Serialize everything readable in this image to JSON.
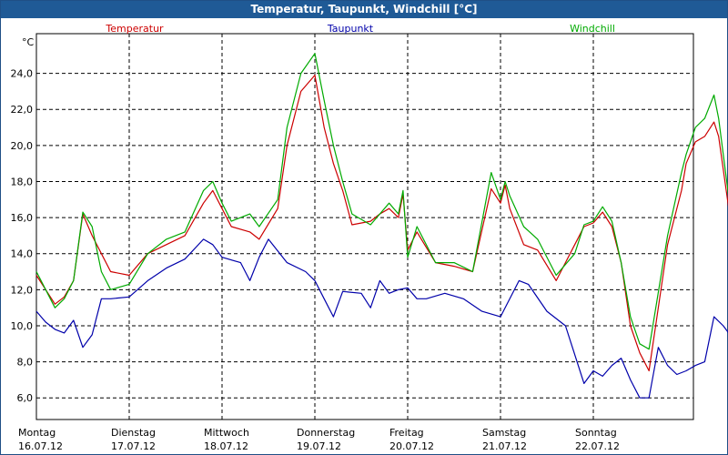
{
  "header": {
    "title": "Temperatur, Taupunkt, Windchill [°C]"
  },
  "chart_data": {
    "type": "line",
    "title": "Temperatur, Taupunkt, Windchill [°C]",
    "ylabel": "°C",
    "ylim": [
      4.8,
      26.2
    ],
    "xlim": [
      0,
      7
    ],
    "grid": true,
    "legend_position": "top",
    "yticks": [
      "6,0",
      "8,0",
      "10,0",
      "12,0",
      "14,0",
      "16,0",
      "18,0",
      "20,0",
      "22,0",
      "24,0"
    ],
    "ytick_values": [
      6,
      8,
      10,
      12,
      14,
      16,
      18,
      20,
      22,
      24
    ],
    "xticks": [
      {
        "day": "Montag",
        "date": "16.07.12"
      },
      {
        "day": "Dienstag",
        "date": "17.07.12"
      },
      {
        "day": "Mittwoch",
        "date": "18.07.12"
      },
      {
        "day": "Donnerstag",
        "date": "19.07.12"
      },
      {
        "day": "Freitag",
        "date": "20.07.12"
      },
      {
        "day": "Samstag",
        "date": "21.07.12"
      },
      {
        "day": "Sonntag",
        "date": "22.07.12"
      }
    ],
    "series": [
      {
        "name": "Temperatur",
        "color": "#cc0000",
        "points": [
          [
            0,
            12.8
          ],
          [
            0.1,
            12.0
          ],
          [
            0.2,
            11.2
          ],
          [
            0.3,
            11.6
          ],
          [
            0.4,
            12.5
          ],
          [
            0.5,
            16.2
          ],
          [
            0.6,
            15.0
          ],
          [
            0.7,
            14.0
          ],
          [
            0.8,
            13.0
          ],
          [
            1.0,
            12.8
          ],
          [
            1.2,
            14.0
          ],
          [
            1.4,
            14.5
          ],
          [
            1.6,
            15.0
          ],
          [
            1.8,
            16.8
          ],
          [
            1.9,
            17.5
          ],
          [
            2.0,
            16.5
          ],
          [
            2.1,
            15.5
          ],
          [
            2.3,
            15.2
          ],
          [
            2.4,
            14.8
          ],
          [
            2.6,
            16.5
          ],
          [
            2.7,
            20.0
          ],
          [
            2.85,
            23.0
          ],
          [
            3.0,
            23.9
          ],
          [
            3.1,
            21.0
          ],
          [
            3.2,
            19.0
          ],
          [
            3.3,
            17.5
          ],
          [
            3.4,
            15.6
          ],
          [
            3.6,
            15.8
          ],
          [
            3.7,
            16.2
          ],
          [
            3.8,
            16.5
          ],
          [
            3.9,
            16.0
          ],
          [
            3.95,
            17.3
          ],
          [
            4.0,
            14.2
          ],
          [
            4.1,
            15.2
          ],
          [
            4.3,
            13.5
          ],
          [
            4.5,
            13.3
          ],
          [
            4.7,
            13.0
          ],
          [
            4.9,
            17.6
          ],
          [
            5.0,
            16.8
          ],
          [
            5.05,
            17.8
          ],
          [
            5.1,
            16.5
          ],
          [
            5.25,
            14.5
          ],
          [
            5.4,
            14.2
          ],
          [
            5.6,
            12.5
          ],
          [
            5.8,
            14.5
          ],
          [
            5.9,
            15.5
          ],
          [
            6.0,
            15.7
          ],
          [
            6.1,
            16.3
          ],
          [
            6.2,
            15.5
          ],
          [
            6.3,
            13.5
          ],
          [
            6.4,
            10.0
          ],
          [
            6.5,
            8.5
          ],
          [
            6.6,
            7.5
          ],
          [
            6.8,
            14.5
          ],
          [
            6.95,
            17.5
          ],
          [
            7.0,
            19.0
          ],
          [
            7.1,
            20.2
          ],
          [
            7.2,
            20.5
          ],
          [
            7.3,
            21.3
          ],
          [
            7.35,
            20.5
          ],
          [
            7.5,
            15.0
          ],
          [
            7.6,
            12.8
          ]
        ]
      },
      {
        "name": "Taupunkt",
        "color": "#0000aa",
        "points": [
          [
            0,
            10.8
          ],
          [
            0.1,
            10.2
          ],
          [
            0.2,
            9.8
          ],
          [
            0.3,
            9.6
          ],
          [
            0.4,
            10.3
          ],
          [
            0.5,
            8.8
          ],
          [
            0.6,
            9.5
          ],
          [
            0.7,
            11.5
          ],
          [
            0.8,
            11.5
          ],
          [
            1.0,
            11.6
          ],
          [
            1.2,
            12.5
          ],
          [
            1.4,
            13.2
          ],
          [
            1.6,
            13.7
          ],
          [
            1.8,
            14.8
          ],
          [
            1.9,
            14.5
          ],
          [
            2.0,
            13.8
          ],
          [
            2.2,
            13.5
          ],
          [
            2.3,
            12.5
          ],
          [
            2.4,
            13.8
          ],
          [
            2.5,
            14.8
          ],
          [
            2.7,
            13.5
          ],
          [
            2.9,
            13.0
          ],
          [
            3.0,
            12.5
          ],
          [
            3.1,
            11.5
          ],
          [
            3.2,
            10.5
          ],
          [
            3.3,
            11.9
          ],
          [
            3.5,
            11.8
          ],
          [
            3.6,
            11.0
          ],
          [
            3.7,
            12.5
          ],
          [
            3.8,
            11.8
          ],
          [
            3.9,
            12.0
          ],
          [
            4.0,
            12.1
          ],
          [
            4.1,
            11.5
          ],
          [
            4.2,
            11.5
          ],
          [
            4.4,
            11.8
          ],
          [
            4.6,
            11.5
          ],
          [
            4.8,
            10.8
          ],
          [
            5.0,
            10.5
          ],
          [
            5.2,
            12.5
          ],
          [
            5.3,
            12.3
          ],
          [
            5.5,
            10.8
          ],
          [
            5.7,
            10.0
          ],
          [
            5.9,
            6.8
          ],
          [
            6.0,
            7.5
          ],
          [
            6.1,
            7.2
          ],
          [
            6.2,
            7.8
          ],
          [
            6.3,
            8.2
          ],
          [
            6.4,
            7.0
          ],
          [
            6.5,
            6.0
          ],
          [
            6.6,
            6.0
          ],
          [
            6.7,
            8.8
          ],
          [
            6.8,
            7.8
          ],
          [
            6.9,
            7.3
          ],
          [
            7.0,
            7.5
          ],
          [
            7.1,
            7.8
          ],
          [
            7.2,
            8.0
          ],
          [
            7.3,
            10.5
          ],
          [
            7.4,
            10.0
          ],
          [
            7.5,
            9.3
          ]
        ]
      },
      {
        "name": "Windchill",
        "color": "#00aa00",
        "points": [
          [
            0,
            13.0
          ],
          [
            0.1,
            12.0
          ],
          [
            0.2,
            11.0
          ],
          [
            0.3,
            11.5
          ],
          [
            0.4,
            12.5
          ],
          [
            0.5,
            16.3
          ],
          [
            0.6,
            15.5
          ],
          [
            0.7,
            13.0
          ],
          [
            0.8,
            12.0
          ],
          [
            1.0,
            12.3
          ],
          [
            1.2,
            14.0
          ],
          [
            1.4,
            14.8
          ],
          [
            1.6,
            15.2
          ],
          [
            1.8,
            17.5
          ],
          [
            1.9,
            18.0
          ],
          [
            2.0,
            16.8
          ],
          [
            2.1,
            15.8
          ],
          [
            2.3,
            16.2
          ],
          [
            2.4,
            15.5
          ],
          [
            2.6,
            17.0
          ],
          [
            2.7,
            21.0
          ],
          [
            2.85,
            24.0
          ],
          [
            3.0,
            25.1
          ],
          [
            3.1,
            22.5
          ],
          [
            3.2,
            20.0
          ],
          [
            3.3,
            18.0
          ],
          [
            3.4,
            16.2
          ],
          [
            3.6,
            15.6
          ],
          [
            3.7,
            16.2
          ],
          [
            3.8,
            16.8
          ],
          [
            3.9,
            16.2
          ],
          [
            3.95,
            17.5
          ],
          [
            4.0,
            13.8
          ],
          [
            4.1,
            15.5
          ],
          [
            4.3,
            13.5
          ],
          [
            4.5,
            13.5
          ],
          [
            4.7,
            13.0
          ],
          [
            4.9,
            18.5
          ],
          [
            5.0,
            17.0
          ],
          [
            5.05,
            18.0
          ],
          [
            5.1,
            17.2
          ],
          [
            5.25,
            15.5
          ],
          [
            5.4,
            14.8
          ],
          [
            5.6,
            12.8
          ],
          [
            5.8,
            14.0
          ],
          [
            5.9,
            15.6
          ],
          [
            6.0,
            15.8
          ],
          [
            6.1,
            16.6
          ],
          [
            6.2,
            15.8
          ],
          [
            6.3,
            13.5
          ],
          [
            6.4,
            10.5
          ],
          [
            6.5,
            9.0
          ],
          [
            6.6,
            8.7
          ],
          [
            6.8,
            15.0
          ],
          [
            6.95,
            18.5
          ],
          [
            7.0,
            19.5
          ],
          [
            7.1,
            21.0
          ],
          [
            7.2,
            21.5
          ],
          [
            7.3,
            22.8
          ],
          [
            7.35,
            21.5
          ],
          [
            7.5,
            15.5
          ],
          [
            7.6,
            13.7
          ]
        ]
      }
    ]
  }
}
